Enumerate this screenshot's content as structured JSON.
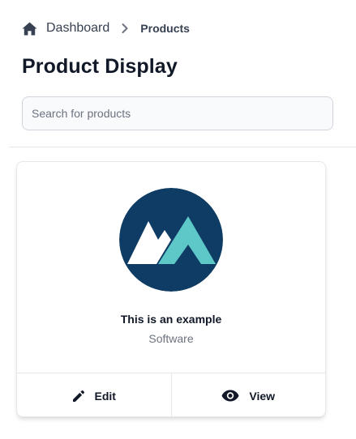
{
  "breadcrumb": {
    "home_label": "Dashboard",
    "current_label": "Products",
    "home_icon": "home-icon",
    "separator_icon": "chevron-right-icon"
  },
  "page": {
    "title": "Product Display"
  },
  "search": {
    "placeholder": "Search for products",
    "value": ""
  },
  "product": {
    "name": "This is an example",
    "category": "Software",
    "logo": {
      "background": "#0f3c64",
      "accent": "#5ec8c8",
      "mark": "#ffffff"
    }
  },
  "actions": {
    "edit_label": "Edit",
    "edit_icon": "pencil-icon",
    "view_label": "View",
    "view_icon": "eye-icon"
  },
  "colors": {
    "text": "#111827",
    "muted": "#6b7280",
    "border": "#e5e7eb"
  }
}
